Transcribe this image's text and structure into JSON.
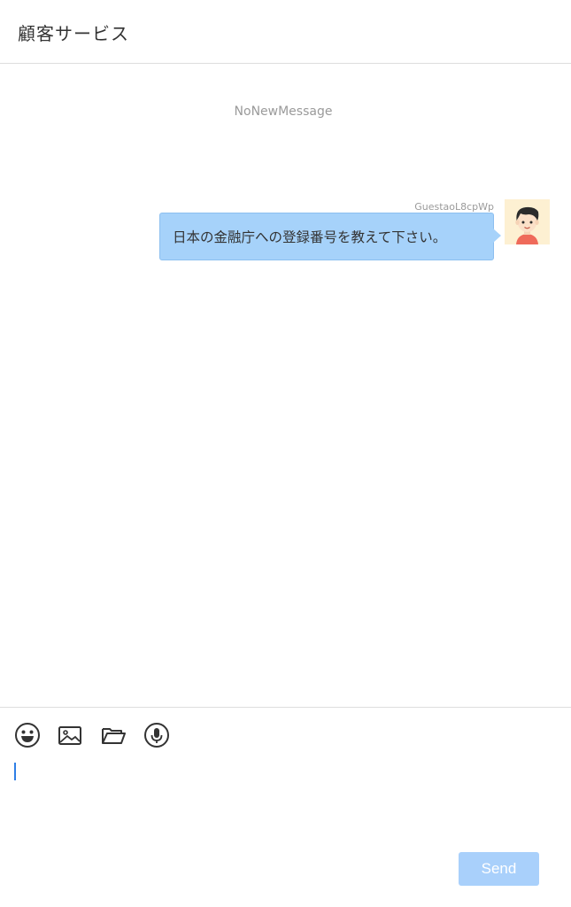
{
  "header": {
    "title": "顧客サービス"
  },
  "messages": {
    "empty_notice": "NoNewMessage",
    "items": [
      {
        "sender": "GuestaoL8cpWp",
        "text": "日本の金融庁への登録番号を教えて下さい。",
        "avatar_icon": "user-avatar-icon"
      }
    ]
  },
  "composer": {
    "toolbar": [
      {
        "icon": "emoji-icon"
      },
      {
        "icon": "image-icon"
      },
      {
        "icon": "folder-icon"
      },
      {
        "icon": "microphone-icon"
      }
    ],
    "input_value": "",
    "send_label": "Send"
  },
  "colors": {
    "bubble": "#a6d2fa",
    "send_button": "#a9d0fb",
    "caret": "#2f7fe6",
    "avatar_bg": "#fdf0d2"
  }
}
